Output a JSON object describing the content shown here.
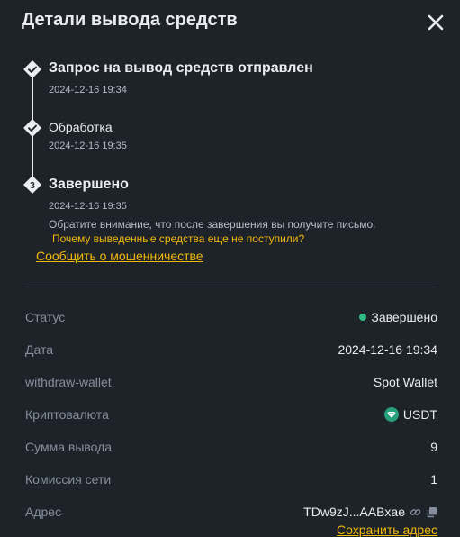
{
  "header": {
    "title": "Детали вывода средств",
    "close_icon": "close-icon"
  },
  "timeline": {
    "steps": [
      {
        "title": "Запрос на вывод средств отправлен",
        "time": "2024-12-16 19:34",
        "state": "done",
        "icon": "check-icon"
      },
      {
        "title": "Обработка",
        "time": "2024-12-16 19:35",
        "state": "done",
        "icon": "check-icon"
      },
      {
        "title": "Завершено",
        "time": "2024-12-16 19:35",
        "state": "current",
        "number": "3"
      }
    ],
    "note": "Обратите внимание, что после завершения вы получите письмо.",
    "help_link": "Почему выведенные средства еще не поступили?",
    "report_link": "Сообщить о мошенничестве"
  },
  "details": {
    "status_label": "Статус",
    "status_value": "Завершено",
    "date_label": "Дата",
    "date_value": "2024-12-16 19:34",
    "wallet_label": "withdraw-wallet",
    "wallet_value": "Spot Wallet",
    "crypto_label": "Криптовалюта",
    "crypto_value": "USDT",
    "amount_label": "Сумма вывода",
    "amount_value": "9",
    "fee_label": "Комиссия сети",
    "fee_value": "1",
    "address_label": "Адрес",
    "address_value": "TDw9zJ...AABxae",
    "save_address": "Сохранить адрес"
  },
  "colors": {
    "background": "#1e2329",
    "accent": "#f0b90b",
    "success": "#2ebd85",
    "usdt": "#26a17b",
    "text_primary": "#eaecef",
    "text_secondary": "#848e9c"
  }
}
